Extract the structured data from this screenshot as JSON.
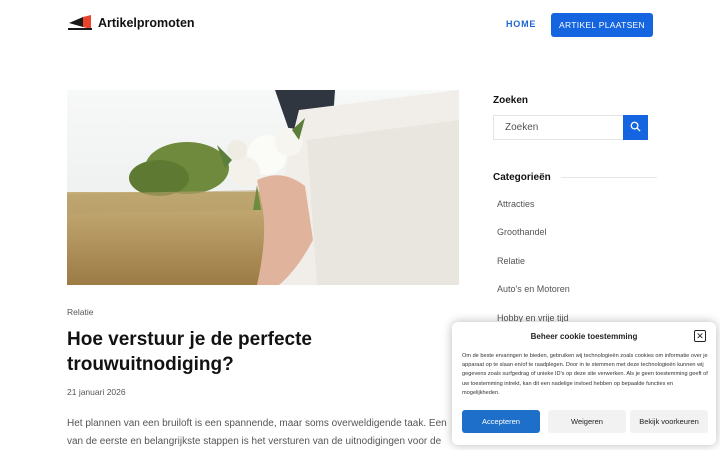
{
  "header": {
    "site_name": "Artikelpromoten",
    "logo_tagline": "ARTIKELPROMOTEN",
    "nav_home": "HOME",
    "cta_label": "ARTIKEL PLAATSEN"
  },
  "post": {
    "category": "Relatie",
    "title": "Hoe verstuur je de perfecte trouwuitnodiging?",
    "date": "21 januari 2026",
    "excerpt": "Het plannen van een bruiloft is een spannende, maar soms overweldigende taak. Een van de eerste en belangrijkste stappen is het versturen van de uitnodigingen voor de"
  },
  "sidebar": {
    "search_heading": "Zoeken",
    "search_placeholder": "Zoeken",
    "categories_heading": "Categorieën",
    "categories": [
      "Attracties",
      "Groothandel",
      "Relatie",
      "Auto's en Motoren",
      "Hobby en vrije tijd"
    ]
  },
  "cookie": {
    "title": "Beheer cookie toestemming",
    "text": "Om de beste ervaringen te bieden, gebruiken wij technologieën zoals cookies om informatie over je apparaat op te slaan en/of te raadplegen. Door in te stemmen met deze technologieën kunnen wij gegevens zoals surfgedrag of unieke ID's op deze site verwerken. Als je geen toestemming geeft of uw toestemming intrekt, kan dit een nadelige invloed hebben op bepaalde functies en mogelijkheden.",
    "accept_label": "Accepteren",
    "deny_label": "Weigeren",
    "prefs_label": "Bekijk voorkeuren",
    "close_symbol": "✕"
  },
  "icons": {
    "logo": "megaphone-logo-icon",
    "search": "search-icon",
    "close": "close-icon"
  },
  "colors": {
    "accent": "#1565e0",
    "accept": "#1e6fc9"
  }
}
